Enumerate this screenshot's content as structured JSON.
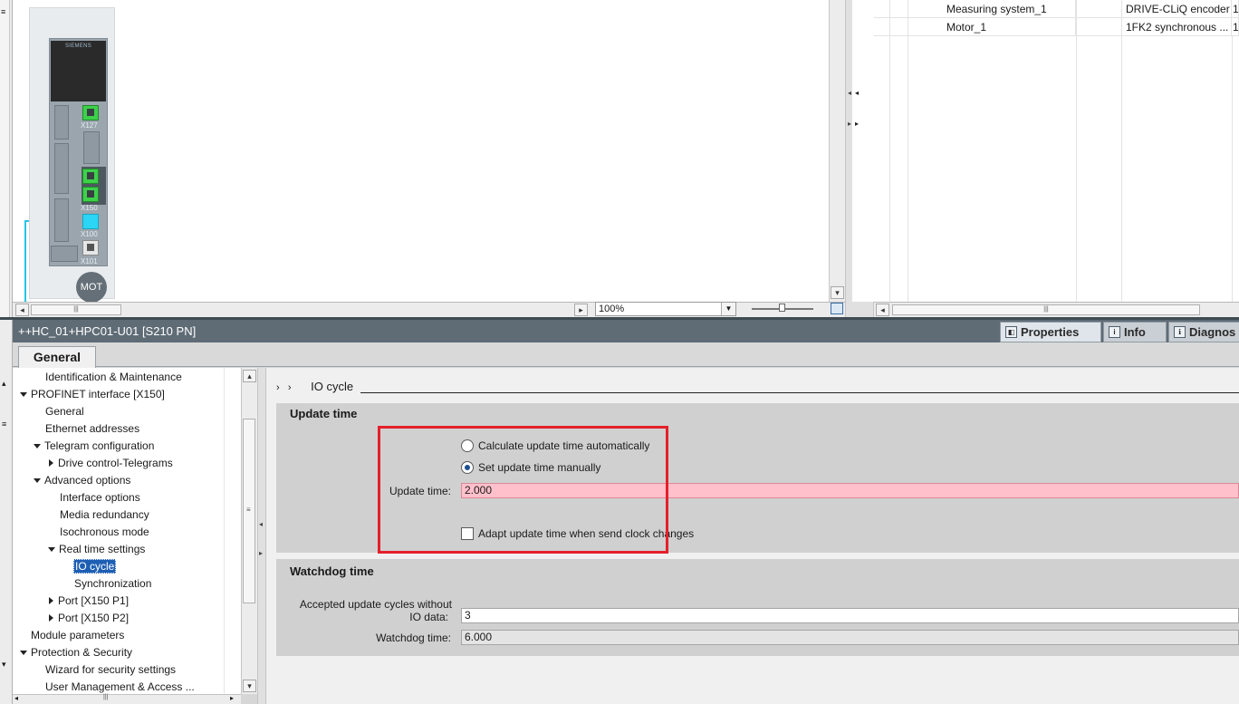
{
  "canvas": {
    "device": {
      "logo_text": "SIEMENS",
      "port_labels": [
        "X127",
        "X150",
        "X100",
        "X101"
      ],
      "motor_label": "MOT"
    },
    "zoom": {
      "value": "100%"
    }
  },
  "device_table": {
    "rows": [
      {
        "name": "Measuring system_1",
        "type": "DRIVE-CLiQ encoder",
        "extra": "1"
      },
      {
        "name": "Motor_1",
        "type": "1FK2 synchronous ...",
        "extra": "1"
      }
    ]
  },
  "properties_header": {
    "title": "++HC_01+HPC01-U01 [S210 PN]",
    "tabs": [
      {
        "label": "Properties",
        "icon": "properties-icon"
      },
      {
        "label": "Info",
        "icon": "info-icon"
      },
      {
        "label": "Diagnos",
        "icon": "diagnostics-icon"
      }
    ],
    "general_tab": "General"
  },
  "nav_tree": {
    "items": [
      "Identification & Maintenance",
      "PROFINET interface [X150]",
      "General",
      "Ethernet addresses",
      "Telegram configuration",
      "Drive control-Telegrams",
      "Advanced options",
      "Interface options",
      "Media redundancy",
      "Isochronous mode",
      "Real time settings",
      "IO cycle",
      "Synchronization",
      "Port [X150 P1]",
      "Port [X150 P2]",
      "Module parameters",
      "Protection & Security",
      "Wizard for security settings",
      "User Management & Access ..."
    ],
    "selected": "IO cycle"
  },
  "content": {
    "breadcrumb": "IO cycle",
    "update_time": {
      "title": "Update time",
      "radio_auto": "Calculate update time automatically",
      "radio_manual": "Set update time manually",
      "selected_radio": "manual",
      "field_label": "Update time:",
      "field_value": "2.000",
      "checkbox_label": "Adapt update time when send clock changes",
      "checkbox_checked": false
    },
    "watchdog": {
      "title": "Watchdog time",
      "cycles_label_line1": "Accepted update cycles without",
      "cycles_label_line2": "IO data:",
      "cycles_value": "3",
      "time_label": "Watchdog time:",
      "time_value": "6.000"
    }
  },
  "colors": {
    "highlight_box": "#e5202a",
    "error_field": "#ffc0cb",
    "selection": "#1e5fb4",
    "title_bar": "#5f6c76"
  }
}
